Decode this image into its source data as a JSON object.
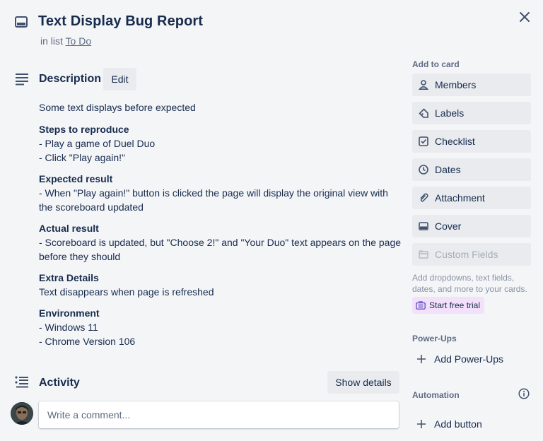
{
  "card": {
    "title": "Text Display Bug Report",
    "in_list_prefix": "in list",
    "list_name": "To Do"
  },
  "description": {
    "title": "Description",
    "edit_label": "Edit",
    "intro": "Some text displays before expected",
    "sections": [
      {
        "heading": "Steps to reproduce",
        "lines": [
          "- Play a game of Duel Duo",
          "- Click \"Play again!\""
        ]
      },
      {
        "heading": "Expected result",
        "lines": [
          "- When \"Play again!\" button is clicked the page will display the original view with the scoreboard updated"
        ]
      },
      {
        "heading": "Actual result",
        "lines": [
          "- Scoreboard is updated, but \"Choose 2!\" and \"Your Duo\" text appears on the page before they should"
        ]
      },
      {
        "heading": "Extra Details",
        "lines": [
          "Text disappears when page is refreshed"
        ]
      },
      {
        "heading": "Environment",
        "lines": [
          "- Windows 11",
          "- Chrome Version 106"
        ]
      }
    ]
  },
  "activity": {
    "title": "Activity",
    "show_details_label": "Show details",
    "comment_placeholder": "Write a comment..."
  },
  "sidebar": {
    "add_to_card_label": "Add to card",
    "buttons": [
      {
        "label": "Members",
        "icon": "person-icon"
      },
      {
        "label": "Labels",
        "icon": "tag-icon"
      },
      {
        "label": "Checklist",
        "icon": "checkbox-icon"
      },
      {
        "label": "Dates",
        "icon": "clock-icon"
      },
      {
        "label": "Attachment",
        "icon": "paperclip-icon"
      },
      {
        "label": "Cover",
        "icon": "cover-icon"
      },
      {
        "label": "Custom Fields",
        "icon": "custom-fields-icon"
      }
    ],
    "custom_fields_help": "Add dropdowns, text fields, dates, and more to your cards.",
    "trial_label": "Start free trial",
    "powerups_label": "Power-Ups",
    "add_powerups_label": "Add Power-Ups",
    "automation_label": "Automation",
    "add_button_label": "Add button"
  },
  "colors": {
    "background": "#f4f5f7",
    "button_gray": "#e9ebee",
    "text_primary": "#172b4d",
    "text_subtle": "#5e6c84",
    "trial_bg": "#f3e1fb"
  }
}
